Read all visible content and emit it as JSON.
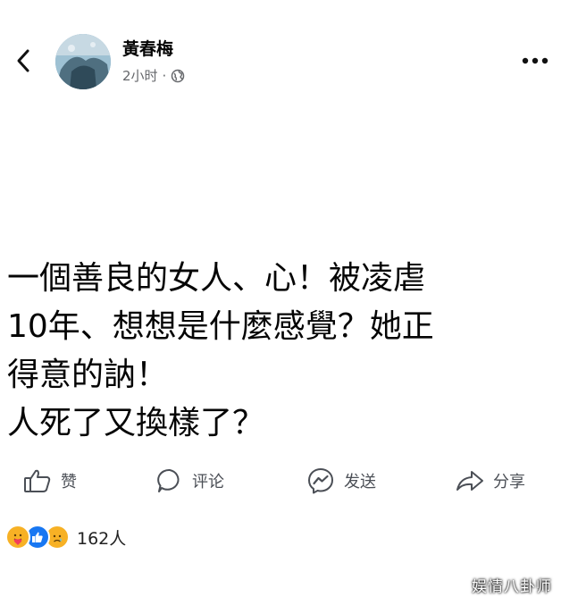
{
  "post": {
    "author": "黃春梅",
    "time": "2小时",
    "separator": "·",
    "text_lines": [
      "一個善良的女人、心！被凌虐",
      "10年、想想是什麼感覺？她正",
      "得意的訥！",
      "人死了又換樣了？"
    ]
  },
  "icons": {
    "back": "chevron-left-icon",
    "more": "more-dots-icon",
    "privacy": "globe-icon"
  },
  "actions": {
    "like": "赞",
    "comment": "评论",
    "send": "发送",
    "share": "分享"
  },
  "reactions": {
    "count": "162人",
    "types": [
      "care",
      "like",
      "sad"
    ]
  },
  "watermark": "娱情八卦师",
  "colors": {
    "like_blue": "#1877f2",
    "reaction_yellow": "#f7b125",
    "secondary_text": "#65676b"
  }
}
